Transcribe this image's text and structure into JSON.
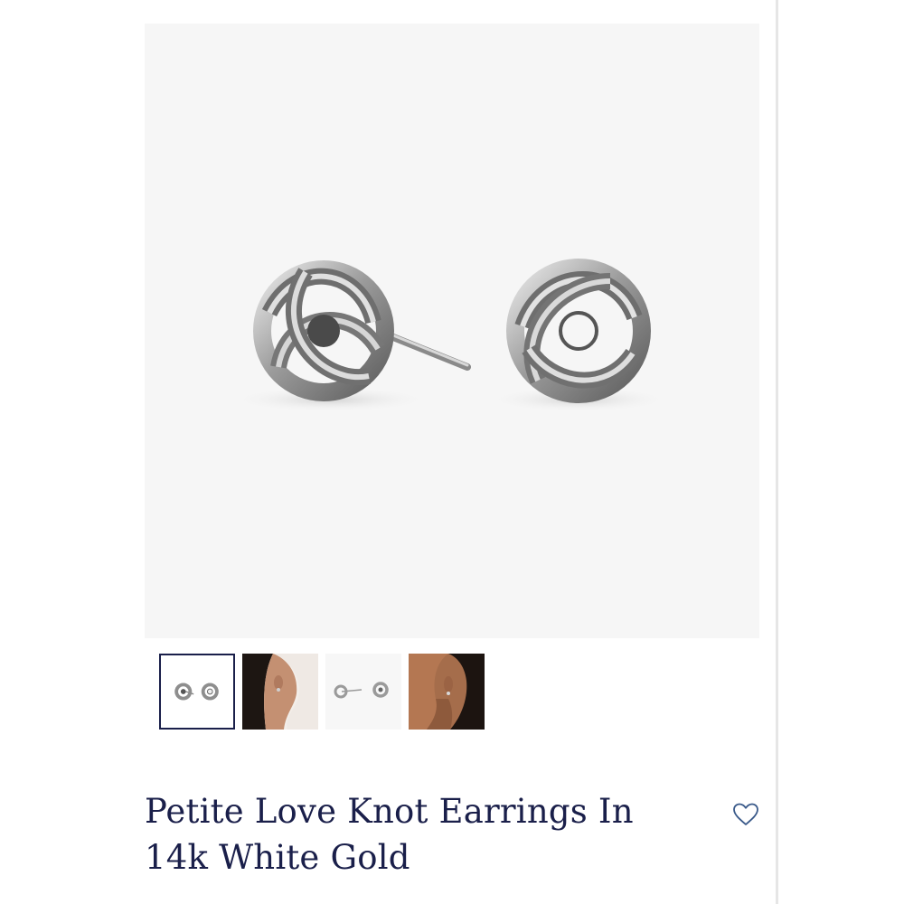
{
  "product": {
    "title": "Petite Love Knot Earrings In 14k White Gold",
    "metal_color": "#9a9a9a",
    "image_background": "#f6f6f6"
  },
  "gallery": {
    "main_image": "earrings-pair-product-photo",
    "selected_index": 0,
    "thumbnails": [
      {
        "subject": "earrings-pair-product-photo"
      },
      {
        "subject": "model-wearing-earring-side-view"
      },
      {
        "subject": "earrings-pair-product-photo-alt"
      },
      {
        "subject": "model-wearing-earring-closeup"
      }
    ]
  },
  "actions": {
    "wishlist_icon": "heart-outline-icon",
    "accent_color": "#1a1f4a",
    "icon_color": "#3a5a8a"
  }
}
